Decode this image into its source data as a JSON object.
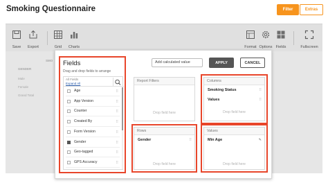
{
  "header": {
    "title": "Smoking Questionnaire",
    "filter_label": "Filter",
    "extras_label": "Extras"
  },
  "toolbar": {
    "save": "Save",
    "export": "Export",
    "grid": "Grid",
    "charts": "Charts",
    "format": "Format",
    "options": "Options",
    "fields": "Fields",
    "fullscreen": "Fullscreen"
  },
  "background_grid": {
    "row_header": "GENDER",
    "col_header": "SMO",
    "rows": [
      "Male",
      "Female",
      "Grand Total"
    ]
  },
  "modal": {
    "fields_title": "Fields",
    "fields_hint": "Drag and drop fields to arrange",
    "search_placeholder": "All Fields",
    "expand_all": "Expand All",
    "field_items": [
      {
        "name": "Age",
        "checked": false
      },
      {
        "name": "App Version",
        "checked": false
      },
      {
        "name": "Counter",
        "checked": false
      },
      {
        "name": "Created By",
        "checked": false
      },
      {
        "name": "Form Version",
        "checked": false
      },
      {
        "name": "Gender",
        "checked": true
      },
      {
        "name": "Geo-tagged",
        "checked": false
      },
      {
        "name": "GPS Accuracy",
        "checked": false
      }
    ],
    "calculated_value_label": "Add calculated value",
    "apply_label": "APPLY",
    "cancel_label": "CANCEL",
    "drop_hint": "Drop field here",
    "zones": {
      "report_filters": {
        "title": "Report Filters",
        "items": []
      },
      "columns": {
        "title": "Columns",
        "items": [
          "Smoking Status",
          "Values"
        ]
      },
      "rows": {
        "title": "Rows",
        "items": [
          "Gender"
        ]
      },
      "values": {
        "title": "Values",
        "items": [
          "Min Age"
        ]
      }
    }
  },
  "colors": {
    "accent": "#f7941d",
    "highlight": "#e8452a",
    "apply_bg": "#555555"
  }
}
